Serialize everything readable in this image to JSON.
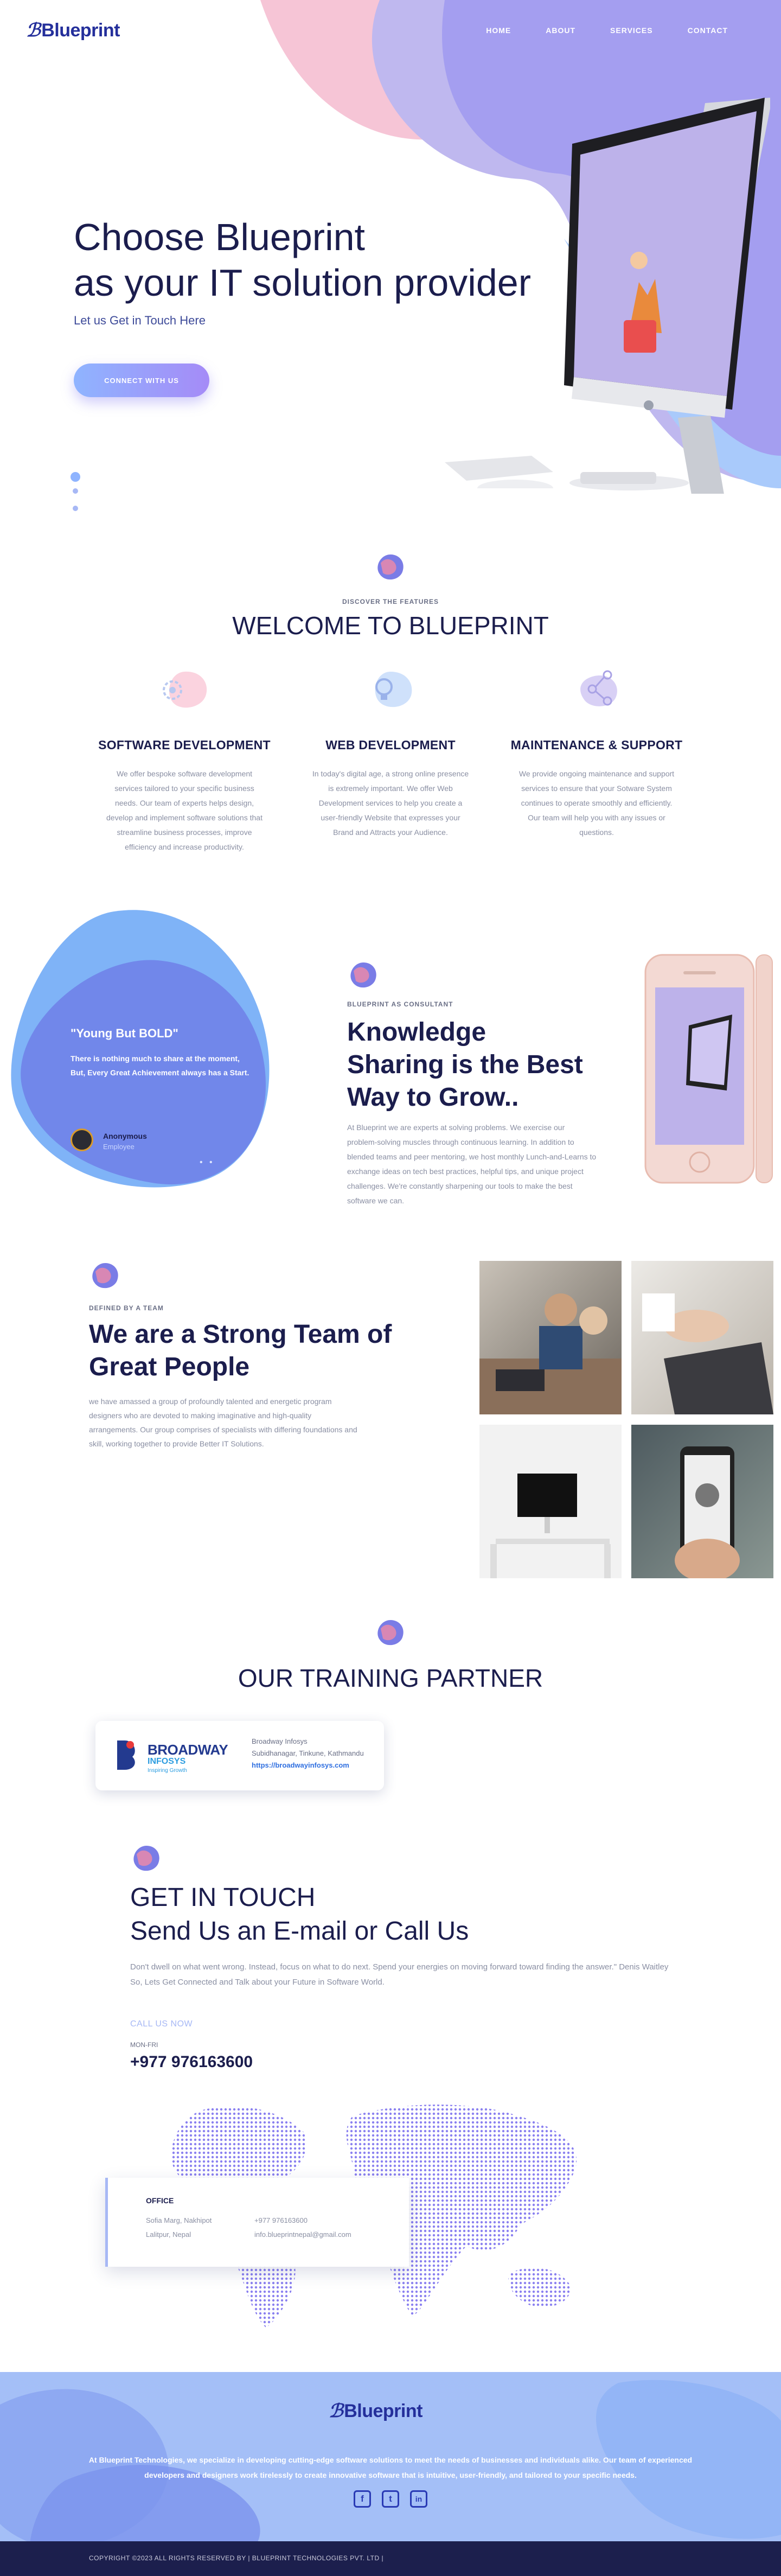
{
  "brand": {
    "name": "Blueprint",
    "logo_icon": "blueprint-logo-icon",
    "accent": "#242f9b",
    "nav_bg": "#a49ef0"
  },
  "nav": {
    "items": [
      "HOME",
      "ABOUT",
      "SERVICES",
      "CONTACT"
    ]
  },
  "hero": {
    "title_line1": "Choose Blueprint",
    "title_line2": "as your IT solution provider",
    "subtitle": "Let us Get in Touch Here",
    "cta": "CONNECT WITH US"
  },
  "features": {
    "label": "DISCOVER THE FEATURES",
    "title": "WELCOME TO BLUEPRINT",
    "items": [
      {
        "icon": "gear-icon",
        "title": "SOFTWARE DEVELOPMENT",
        "text": "We offer bespoke software development services tailored to your specific business needs. Our team of experts helps design, develop and implement software solutions that streamline business processes, improve efficiency and increase productivity."
      },
      {
        "icon": "lightbulb-icon",
        "title": "WEB DEVELOPMENT",
        "text": "In today's digital age, a strong online presence is extremely important. We offer Web Development services to help you create a user-friendly Website that expresses your Brand and Attracts your Audience."
      },
      {
        "icon": "share-icon",
        "title": "MAINTENANCE & SUPPORT",
        "text": "We provide ongoing maintenance and support services to ensure that your Sotware System continues to operate smoothly and efficiently. Our team will help you with any issues or questions."
      }
    ]
  },
  "testimonial": {
    "quote_title": "\"Young But BOLD\"",
    "quote": "There is nothing much to share at the moment, But, Every Great Achievement always has a Start.",
    "author": "Anonymous",
    "role": "Employee"
  },
  "knowledge": {
    "label": "BLUEPRINT AS CONSULTANT",
    "title": "Knowledge Sharing is the Best Way to Grow..",
    "text": "At Blueprint we are experts at solving problems. We exercise our problem-solving muscles through continuous learning. In addition to blended teams and peer mentoring, we host monthly Lunch-and-Learns to exchange ideas on tech best practices, helpful tips, and unique project challenges. We're constantly sharpening our tools to make the best software we can."
  },
  "team": {
    "label": "DEFINED BY A TEAM",
    "title": "We are a Strong Team of Great People",
    "text": "we have amassed a group of profoundly talented and energetic program designers who are devoted to making imaginative and high-quality arrangements. Our group comprises of specialists with differing foundations and skill, working together to provide Better IT Solutions."
  },
  "partner": {
    "title": "OUR TRAINING PARTNER",
    "logo_main": "BROADWAY",
    "logo_sub": "INFOSYS",
    "logo_tag": "Inspiring Growth",
    "name": "Broadway Infosys",
    "address": "Subidhanagar, Tinkune, Kathmandu",
    "url": "https://broadwayinfosys.com"
  },
  "contact": {
    "title1": "GET IN TOUCH",
    "title2": "Send Us an E-mail or Call Us",
    "text": "Don't dwell on what went wrong. Instead, focus on what to do next. Spend your energies on moving forward toward finding the answer.\" Denis Waitley So, Lets Get Connected and Talk about your Future in Software World.",
    "call_label": "CALL US NOW",
    "hours": "MON-FRI",
    "phone": "+977 976163600",
    "office_label": "OFFICE",
    "address1": "Sofia Marg, Nakhipot",
    "address2": "Lalitpur, Nepal",
    "office_phone": "+977 976163600",
    "email": "info.blueprintnepal@gmail.com"
  },
  "footer": {
    "text": "At Blueprint Technologies, we specialize in developing cutting-edge software solutions to meet the needs of businesses and individuals alike. Our team of experienced developers and designers work tirelessly to create innovative software that is intuitive, user-friendly, and tailored to your specific needs.",
    "social": [
      "f",
      "t",
      "in"
    ],
    "copyright": "COPYRIGHT ©2023 ALL RIGHTS RESERVED BY | BLUEPRINT TECHNOLOGIES PVT. LTD |"
  }
}
